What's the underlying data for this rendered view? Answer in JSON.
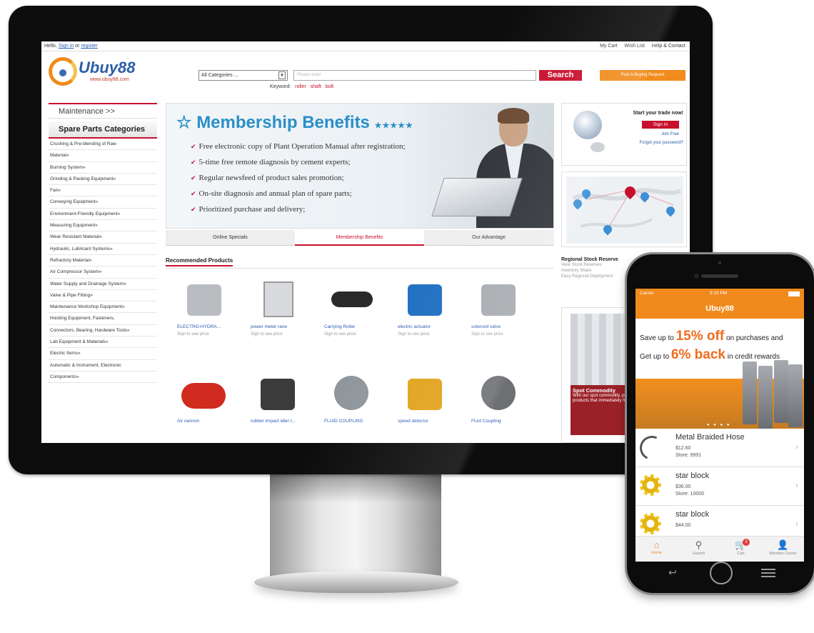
{
  "desktop": {
    "topbar": {
      "hello": "Hello,",
      "sign_in": "Sign in",
      "or": "or",
      "register": "register",
      "right_links": [
        "My Cart",
        "Wish List",
        "Help & Contact"
      ]
    },
    "logo": {
      "name": "Ubuy88",
      "url": "www.ubuy88.com"
    },
    "search": {
      "category": "All Categories ...",
      "placeholder": "Please enter",
      "button": "Search",
      "post_button": "Post A Buying Request",
      "keywords_label": "Keyword:",
      "keywords": [
        "roller",
        "shaft",
        "bolt"
      ]
    },
    "sidebar": {
      "maintenance": "Maintenance >>",
      "heading": "Spare Parts Categories",
      "categories": [
        "Crushing & Pre-blending of Raw",
        "Material»",
        "Burning System»",
        "Grinding & Packing Equipment»",
        "Fan»",
        "Conveying Equipment»",
        "Environment-Friendly Equipment»",
        "Measuring Equipment»",
        "Wear Resistant Material»",
        "Hydraulic, Lubricant Systems»",
        "Refractory Material»",
        "Air Compressor System»",
        "Water Supply and Drainage System»",
        "Valve & Pipe Fitting»",
        "Maintenance Workshop Equipment»",
        "Hoisting Equipment, Fasteners,",
        "Connectors, Bearing, Hardware Tools»",
        "Lab Equipment & Materials»",
        "Electric Items»",
        "Automatic & Instrument, Electronic",
        "Components»"
      ]
    },
    "banner": {
      "title": "Membership Benefits",
      "stars": "★★★★★",
      "bullets": [
        "Free electronic copy of Plant Operation Manual after registration;",
        "5-time free remote diagnosis by cement experts;",
        "Regular newsfeed of product sales promotion;",
        "On-site diagnosis and annual plan of spare parts;",
        "Prioritized purchase and delivery;"
      ]
    },
    "tabs": [
      "Online Specials",
      "Membership Benefits",
      "Our Advantage"
    ],
    "recommended": {
      "heading": "Recommended Products",
      "products": [
        {
          "name": "ELECTRO-HYDRA...",
          "price": "Sign to see price"
        },
        {
          "name": "power meter rane",
          "price": "Sign to see price"
        },
        {
          "name": "Carrying Roller",
          "price": "Sign to see price"
        },
        {
          "name": "electric actuator",
          "price": "Sign to see price"
        },
        {
          "name": "solenoid valve",
          "price": "Sign to see price"
        },
        {
          "name": "Air cannon",
          "price": ""
        },
        {
          "name": "rubber impact idler t...",
          "price": ""
        },
        {
          "name": "FLUID COUPLING",
          "price": ""
        },
        {
          "name": "speed detector",
          "price": ""
        },
        {
          "name": "Fluid Coupling",
          "price": ""
        }
      ]
    },
    "right": {
      "start": "Start your trade now!",
      "sign_in": "Sign In",
      "join": "Join Free",
      "forgot": "Forgot your password?",
      "regional_heading": "Regional Stock Reserve",
      "regional_links": [
        "View Stock Reserves",
        "Inventory Share",
        "Easy Regional Deployment"
      ],
      "spot_title": "Spot Commodity",
      "spot_desc": "With our spot commodity, provide customers with products that immediately from their nearest local."
    }
  },
  "mobile": {
    "status": {
      "carrier": "Carrier",
      "time": "5:15 PM"
    },
    "title": "Ubuy88",
    "promo": {
      "line1_pre": "Save up to",
      "line1_big": "15% off",
      "line1_post": "on purchases and",
      "line2_pre": "Get up to",
      "line2_big": "6% back",
      "line2_post": "in credit rewards"
    },
    "items": [
      {
        "name": "Metal Braided Hose",
        "price": "$12.60",
        "store": "Store: 9991"
      },
      {
        "name": "star block",
        "price": "$36.00",
        "store": "Store: 10000"
      },
      {
        "name": "star block",
        "price": "$44.00",
        "store": ""
      }
    ],
    "tabbar": [
      {
        "label": "Home",
        "icon": "home-icon"
      },
      {
        "label": "Search",
        "icon": "search-icon"
      },
      {
        "label": "Cart",
        "icon": "cart-icon"
      },
      {
        "label": "Member Center",
        "icon": "user-icon"
      }
    ],
    "cart_badge": "3",
    "colors": {
      "accent": "#f08a1c",
      "brand_red": "#c8102e",
      "link": "#2a5db0"
    }
  }
}
